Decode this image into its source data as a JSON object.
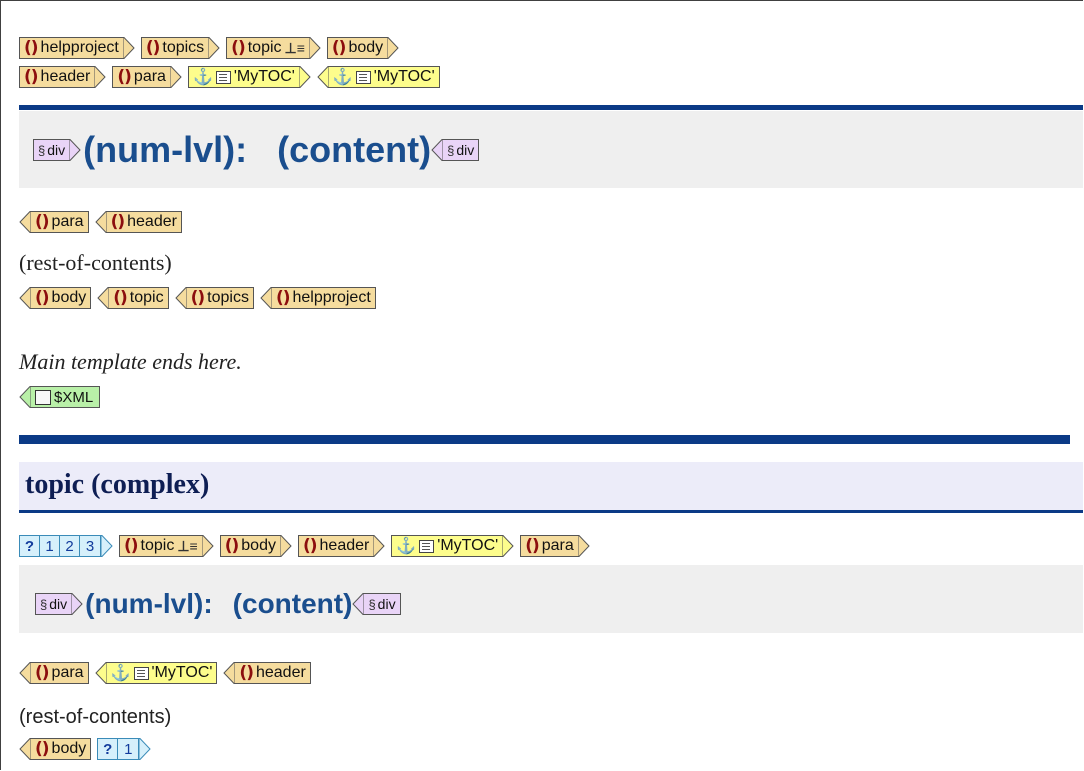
{
  "breadcrumb_top": {
    "row1": [
      "helpproject",
      "topics",
      "topic",
      "body"
    ],
    "row2": [
      "header",
      "para"
    ],
    "toc1": "'MyTOC'",
    "toc2": "'MyTOC'"
  },
  "section1": {
    "div_start": "div",
    "num_lvl": "(num-lvl):",
    "content": "(content)",
    "div_end": "div"
  },
  "closing1": [
    "para",
    "header"
  ],
  "rest_of_contents_1": "(rest-of-contents)",
  "closing2": [
    "body",
    "topic",
    "topics",
    "helpproject"
  ],
  "main_template_ends": "Main template ends here.",
  "xml_end": "$XML",
  "template_title": "topic (complex)",
  "section2": {
    "seg": [
      "?",
      "1",
      "2",
      "3"
    ],
    "tags": [
      "topic",
      "body",
      "header"
    ],
    "toc": "'MyTOC'",
    "para": "para",
    "div_start": "div",
    "num_lvl": "(num-lvl):",
    "content": "(content)",
    "div_end": "div"
  },
  "closing3": {
    "para": "para",
    "toc": "'MyTOC'",
    "header": "header"
  },
  "rest_of_contents_2": "(rest-of-contents)",
  "closing4": {
    "body": "body",
    "seg": [
      "?",
      "1"
    ]
  },
  "colors": {
    "tag_element": "#f5dc9e",
    "tag_anchor": "#fdfd8c",
    "tag_div": "#e9d4f7",
    "tag_xml": "#b9f0a8",
    "tag_choice": "#d6f0fb",
    "heading": "#1a4e8e",
    "rule": "#0b3a86"
  },
  "icons": [
    "element-paren-icon",
    "anchor-icon",
    "toc-box-icon",
    "hierarchy-icon",
    "section-icon",
    "xml-document-icon"
  ]
}
